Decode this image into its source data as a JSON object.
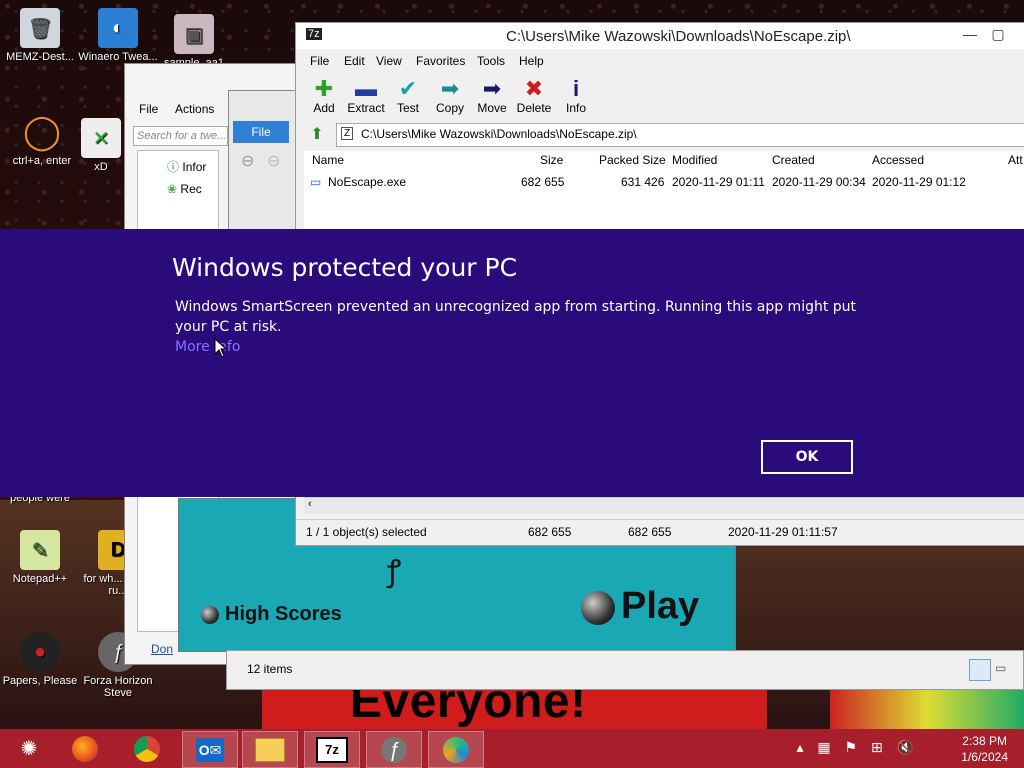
{
  "desktop": {
    "icons": [
      {
        "label": "MEMZ-Dest...",
        "icon": "recycle-bin-icon"
      },
      {
        "label": "Winaero Twea...",
        "icon": "winaero-icon"
      },
      {
        "label": "sample_aa1",
        "icon": "image-icon"
      },
      {
        "label": "ctrl+a, enter",
        "icon": "ring-icon"
      },
      {
        "label": "xD",
        "icon": "x-icon"
      },
      {
        "label": "Notepad++",
        "icon": "notepad-icon"
      },
      {
        "label": "for wh... some ru...",
        "icon": "document-icon"
      },
      {
        "label": "Papers, Please",
        "icon": "papers-please-icon"
      },
      {
        "label": "Forza Horizon Steve",
        "icon": "flash-icon"
      },
      {
        "label": "people were",
        "icon": "text-icon"
      }
    ],
    "poster_text": "Everyone!"
  },
  "left_window": {
    "menu": [
      "File",
      "Actions"
    ],
    "search_placeholder": "Search for a twe...",
    "tree": [
      "Infor",
      "Rec"
    ],
    "file_tab": "File",
    "bottom_link": "Don"
  },
  "game": {
    "high_scores": "High Scores",
    "play": "Play"
  },
  "explorer_status": "12 items",
  "zip": {
    "title": "C:\\Users\\Mike Wazowski\\Downloads\\NoEscape.zip\\",
    "menu": [
      "File",
      "Edit",
      "View",
      "Favorites",
      "Tools",
      "Help"
    ],
    "tools": [
      {
        "label": "Add",
        "icon": "add-icon"
      },
      {
        "label": "Extract",
        "icon": "extract-icon"
      },
      {
        "label": "Test",
        "icon": "test-icon"
      },
      {
        "label": "Copy",
        "icon": "copy-icon"
      },
      {
        "label": "Move",
        "icon": "move-icon"
      },
      {
        "label": "Delete",
        "icon": "delete-icon"
      },
      {
        "label": "Info",
        "icon": "info-icon"
      }
    ],
    "address": "C:\\Users\\Mike Wazowski\\Downloads\\NoEscape.zip\\",
    "columns": [
      "Name",
      "Size",
      "Packed Size",
      "Modified",
      "Created",
      "Accessed",
      "Att"
    ],
    "rows": [
      {
        "name": "NoEscape.exe",
        "size": "682 655",
        "packed": "631 426",
        "modified": "2020-11-29 01:11",
        "created": "2020-11-29 00:34",
        "accessed": "2020-11-29 01:12"
      }
    ],
    "status": {
      "selected": "1 / 1 object(s) selected",
      "size": "682 655",
      "packed": "682 655",
      "date": "2020-11-29 01:11:57"
    }
  },
  "smartscreen": {
    "title": "Windows protected your PC",
    "body": "Windows SmartScreen prevented an unrecognized app from starting. Running this app might put your PC at risk.",
    "more_info": "More info",
    "ok": "OK",
    "bg_color": "#2b0a7c"
  },
  "taskbar": {
    "apps": [
      {
        "name": "start",
        "icon": "start-orb-icon"
      },
      {
        "name": "firefox",
        "icon": "firefox-icon"
      },
      {
        "name": "chrome",
        "icon": "chrome-icon"
      },
      {
        "name": "outlook",
        "icon": "outlook-icon"
      },
      {
        "name": "explorer",
        "icon": "folder-icon"
      },
      {
        "name": "7zip",
        "icon": "7zip-icon"
      },
      {
        "name": "flash",
        "icon": "flash-icon"
      },
      {
        "name": "edge",
        "icon": "edge-icon"
      }
    ],
    "time": "2:38 PM",
    "date": "1/6/2024"
  }
}
